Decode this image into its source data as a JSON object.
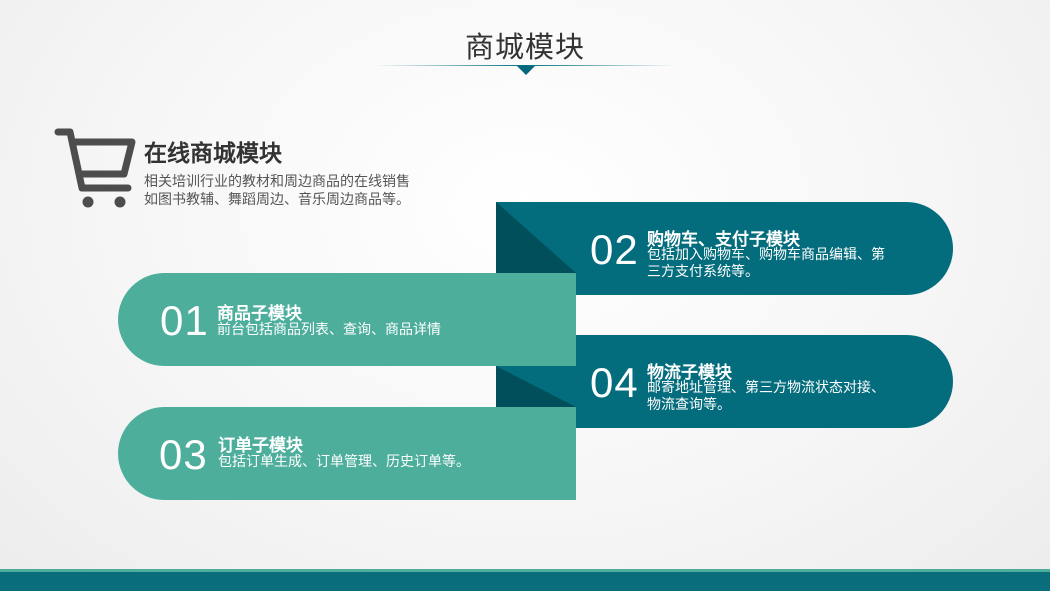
{
  "header": {
    "title": "商城模块"
  },
  "intro": {
    "icon": "shopping-cart-icon",
    "title": "在线商城模块",
    "desc_lines": [
      "相关培训行业的教材和周边商品的在线销售",
      "如图书教辅、舞蹈周边、音乐周边商品等。"
    ]
  },
  "modules": [
    {
      "num": "01",
      "title": "商品子模块",
      "desc_lines": [
        "前台包括商品列表、查询、商品详情"
      ]
    },
    {
      "num": "02",
      "title": "购物车、支付子模块",
      "desc_lines": [
        "包括加入购物车、购物车商品编辑、第",
        "三方支付系统等。"
      ]
    },
    {
      "num": "03",
      "title": "订单子模块",
      "desc_lines": [
        "包括订单生成、订单管理、历史订单等。"
      ]
    },
    {
      "num": "04",
      "title": "物流子模块",
      "desc_lines": [
        "邮寄地址管理、第三方物流状态对接、",
        "物流查询等。"
      ]
    }
  ],
  "colors": {
    "dark_teal": "#036c7d",
    "light_teal": "#4cae9b",
    "shadow": "#024f5c",
    "text_dark": "#333333"
  }
}
